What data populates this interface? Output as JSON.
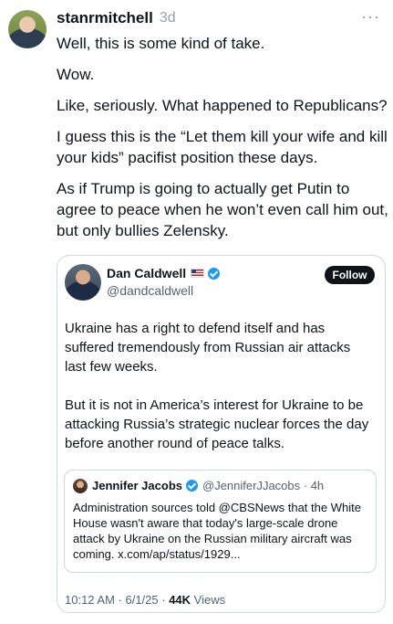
{
  "post": {
    "username": "stanrmitchell",
    "time": "3d",
    "more": "···",
    "paragraphs": [
      "Well, this is some kind of take.",
      "Wow.",
      "Like, seriously. What happened to Republicans?",
      "I guess this is the “Let them kill your wife and kill your kids” pacifist position these days.",
      "As if Trump is going to actually get Putin to agree to peace when he won’t even call him out, but only bullies Zelensky."
    ]
  },
  "quote": {
    "name": "Dan Caldwell",
    "handle": "@dandcaldwell",
    "follow_label": "Follow",
    "paragraphs": [
      "Ukraine has a right to defend itself and has suffered tremendously from Russian air attacks last few weeks.",
      "But it is not in America’s interest for Ukraine to be attacking Russia’s strategic nuclear forces the day before another round of peace talks."
    ],
    "nested": {
      "name": "Jennifer Jacobs",
      "meta": "@JenniferJJacobs · 4h",
      "text": "Administration sources told @CBSNews that the White House wasn't aware that today's large-scale drone attack by Ukraine on the Russian military aircraft was coming. x.com/ap/status/1929..."
    },
    "footer": {
      "timestamp": "10:12 AM · 6/1/25 · ",
      "views_count": "44K",
      "views_label": " Views"
    }
  },
  "colors": {
    "verified": "#1d9bf0",
    "follow_bg": "#0f1419",
    "muted": "#536471"
  }
}
